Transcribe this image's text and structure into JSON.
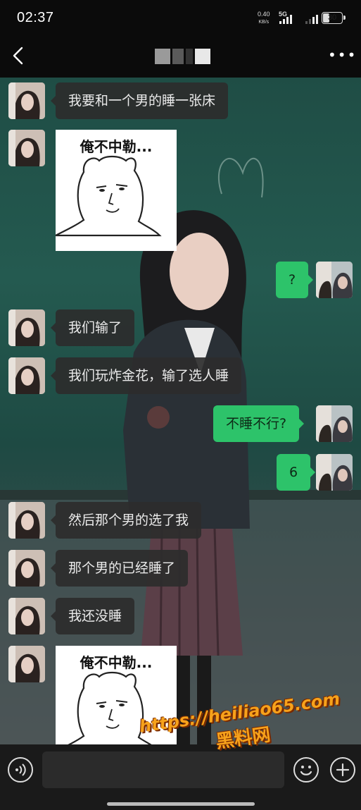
{
  "status_bar": {
    "time": "02:37",
    "net_speed": "0.40",
    "net_unit": "KB/s",
    "network": "5G",
    "battery": "30"
  },
  "header": {
    "title_redacted": true,
    "more_label": "•••"
  },
  "sticker_caption": "俺不中勒...",
  "messages": [
    {
      "side": "in",
      "type": "text",
      "text": "我要和一个男的睡一张床"
    },
    {
      "side": "in",
      "type": "sticker"
    },
    {
      "side": "out",
      "type": "text",
      "text": "?"
    },
    {
      "side": "in",
      "type": "text",
      "text": "我们输了"
    },
    {
      "side": "in",
      "type": "text",
      "text": "我们玩炸金花，输了选人睡"
    },
    {
      "side": "out",
      "type": "text",
      "text": "不睡不行?"
    },
    {
      "side": "out",
      "type": "text",
      "text": "6"
    },
    {
      "side": "in",
      "type": "text",
      "text": "然后那个男的选了我"
    },
    {
      "side": "in",
      "type": "text",
      "text": "那个男的已经睡了"
    },
    {
      "side": "in",
      "type": "text",
      "text": "我还没睡"
    },
    {
      "side": "in",
      "type": "sticker"
    }
  ],
  "input": {
    "value": ""
  },
  "watermark": {
    "url": "https://heiliao65.com",
    "name": "黑料网"
  },
  "colors": {
    "outgoing_bubble": "#2dc36a",
    "incoming_bubble": "#2c2c2c",
    "chat_background": "#1f4d45",
    "watermark": "#f7a21b"
  }
}
